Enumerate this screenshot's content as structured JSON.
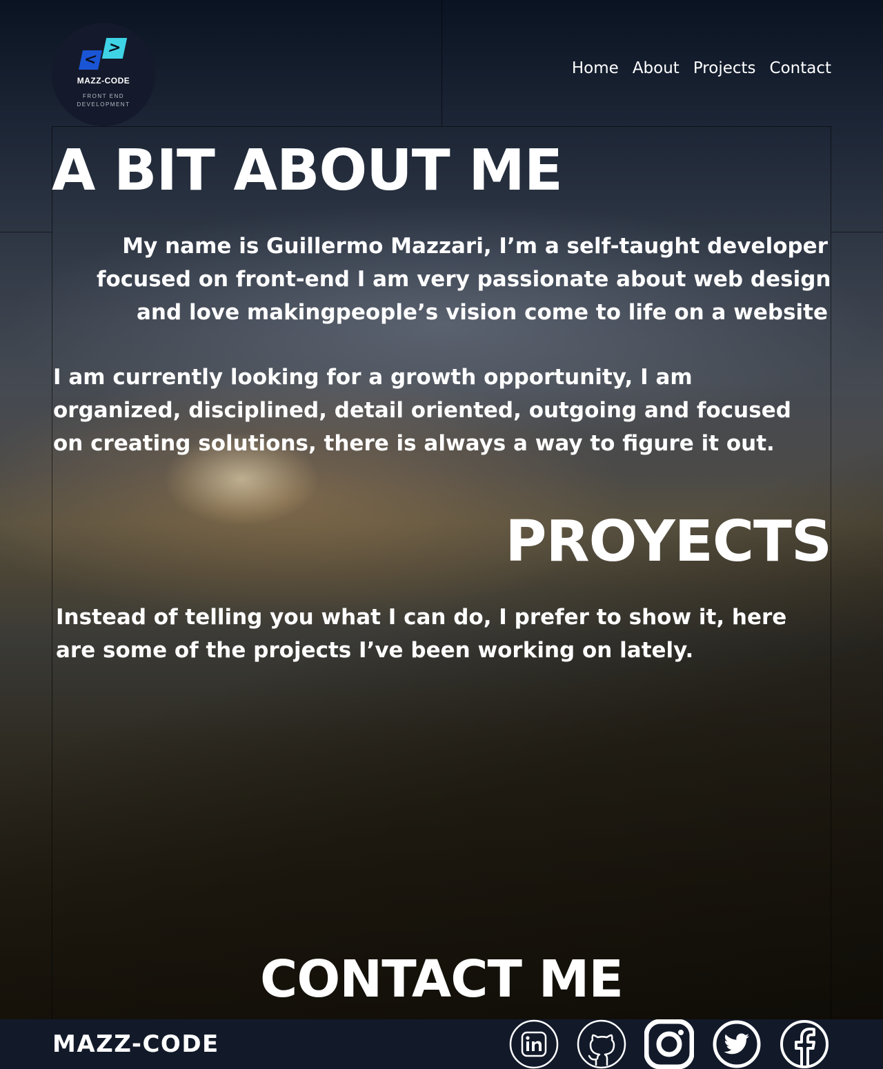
{
  "logo": {
    "name": "MAZZ-CODE",
    "tagline": "FRONT END DEVELOPMENT",
    "left_glyph": "<",
    "right_glyph": ">",
    "colors": {
      "left": "#1a55d6",
      "right": "#3fd3e6"
    }
  },
  "nav": {
    "items": [
      {
        "label": "Home"
      },
      {
        "label": "About"
      },
      {
        "label": "Projects"
      },
      {
        "label": "Contact"
      }
    ]
  },
  "about": {
    "title": "A BIT ABOUT ME",
    "intro": [
      "My name is Guillermo Mazzari, I’m a  self-taught developer",
      "focused on front-end I am very passionate about web design ",
      "and love makingpeople’s vision come to life on a website"
    ],
    "more": "I am currently looking for a growth opportunity, I am organized, disciplined, detail oriented, outgoing and focused on creating solutions, there is always a way to figure it out."
  },
  "projects": {
    "title": "PROYECTS",
    "text": "Instead of telling you what I can do, I prefer to show it, here are some of the projects I’ve been working on lately."
  },
  "contact": {
    "title": "CONTACT ME"
  },
  "footer": {
    "brand": "MAZZ-CODE",
    "socials": [
      {
        "icon": "linkedin-icon"
      },
      {
        "icon": "github-icon"
      },
      {
        "icon": "instagram-icon"
      },
      {
        "icon": "twitter-icon"
      },
      {
        "icon": "facebook-icon"
      }
    ]
  }
}
